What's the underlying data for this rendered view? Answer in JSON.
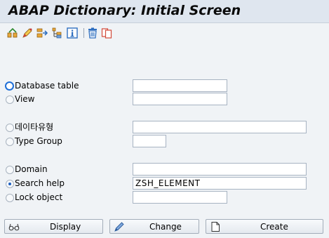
{
  "window": {
    "title": "ABAP Dictionary: Initial Screen"
  },
  "toolbar": {
    "icons": [
      "other-object-icon",
      "edit-icon",
      "where-used-icon",
      "hierarchy-icon",
      "information-icon",
      "delete-icon",
      "copy-icon"
    ]
  },
  "options": [
    {
      "label": "Database table",
      "selected": false,
      "focused": true,
      "value": ""
    },
    {
      "label": "View",
      "selected": false,
      "value": ""
    },
    {
      "label": "데이타유형",
      "selected": false,
      "value": ""
    },
    {
      "label": "Type Group",
      "selected": false,
      "value": ""
    },
    {
      "label": "Domain",
      "selected": false,
      "value": ""
    },
    {
      "label": "Search help",
      "selected": true,
      "value": "ZSH_ELEMENT"
    },
    {
      "label": "Lock object",
      "selected": false,
      "value": ""
    }
  ],
  "buttons": {
    "display": "Display",
    "change": "Change",
    "create": "Create"
  }
}
